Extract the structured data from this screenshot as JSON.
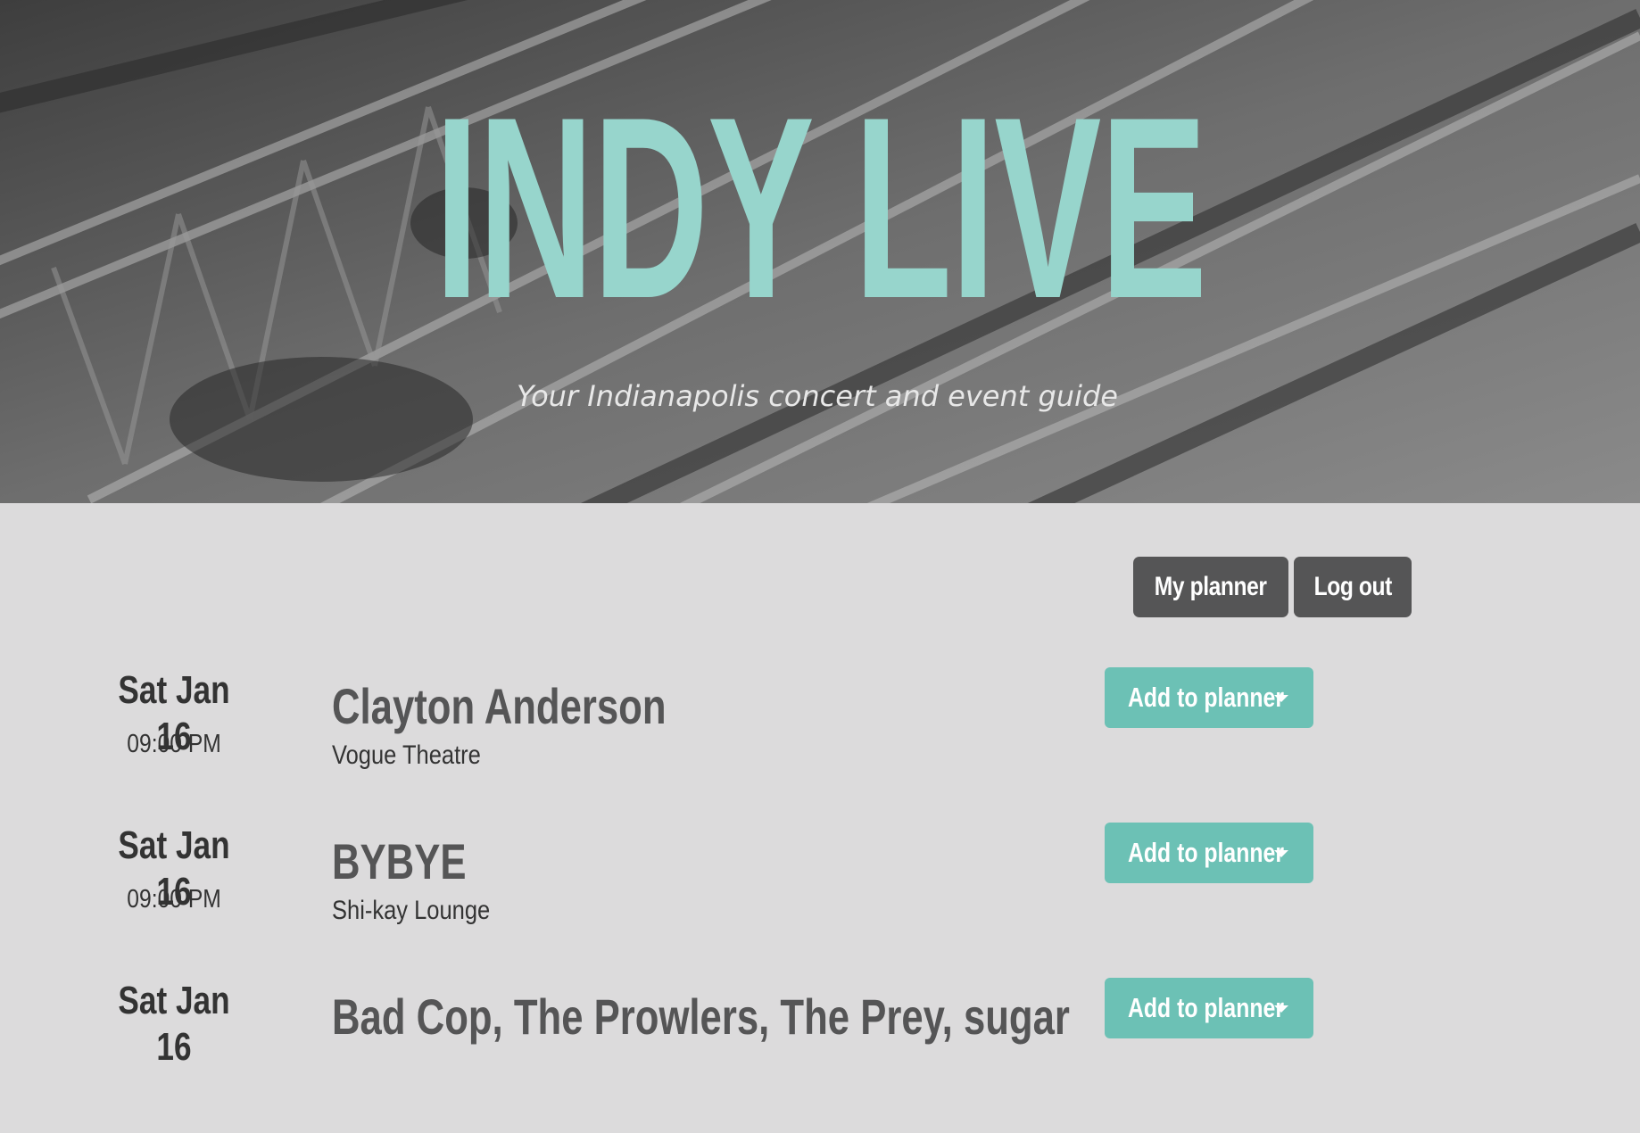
{
  "hero": {
    "title": "INDY LIVE",
    "subtitle": "Your Indianapolis concert and event guide"
  },
  "nav": {
    "my_planner": "My planner",
    "log_out": "Log out"
  },
  "events": [
    {
      "date": "Sat Jan 16",
      "time": "09:00 PM",
      "title": "Clayton Anderson",
      "venue": "Vogue Theatre",
      "button": "Add to planner"
    },
    {
      "date": "Sat Jan 16",
      "time": "09:00 PM",
      "title": "BYBYE",
      "venue": "Shi-kay Lounge",
      "button": "Add to planner"
    },
    {
      "date": "Sat Jan 16",
      "time": "",
      "title": "Bad Cop, The Prowlers, The Prey, sugar",
      "venue": "",
      "button": "Add to planner"
    }
  ],
  "colors": {
    "accent": "#97d5cc",
    "button_teal": "#6cc1b5",
    "button_dark": "#555556",
    "page_bg": "#dcdbdc"
  },
  "icons": {
    "dropdown": "caret-down-icon"
  }
}
